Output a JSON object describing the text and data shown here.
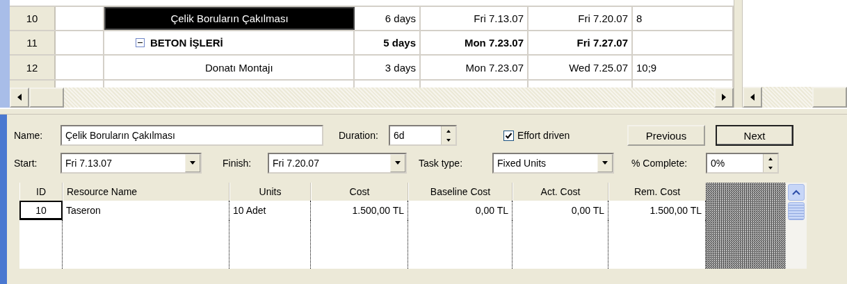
{
  "task_table": {
    "rows": [
      {
        "id": "10",
        "kind": "task",
        "name": "Çelik Boruların Çakılması",
        "duration": "6 days",
        "start": "Fri 7.13.07",
        "finish": "Fri 7.20.07",
        "predecessors": "8",
        "selected": true
      },
      {
        "id": "11",
        "kind": "summary",
        "expanded": true,
        "name": "BETON İŞLERİ",
        "duration": "5 days",
        "start": "Mon 7.23.07",
        "finish": "Fri 7.27.07",
        "selected": false
      },
      {
        "id": "12",
        "kind": "task",
        "name": "Donatı Montajı",
        "duration": "3 days",
        "start": "Mon 7.23.07",
        "finish": "Wed 7.25.07",
        "predecessors": "10;9",
        "selected": false
      }
    ]
  },
  "task_form": {
    "name_label": "Name:",
    "name": "Çelik Boruların Çakılması",
    "duration_label": "Duration:",
    "duration": "6d",
    "effort_driven": {
      "label": "Effort driven",
      "checked": true
    },
    "buttons": [
      {
        "label": "Previous",
        "default": false
      },
      {
        "label": "Next",
        "default": true
      }
    ],
    "start_label": "Start:",
    "start": "Fri 7.13.07",
    "finish_label": "Finish:",
    "finish": "Fri 7.20.07",
    "task_type_label": "Task type:",
    "task_type": "Fixed Units",
    "complete_label": "% Complete:",
    "complete": "0%"
  },
  "resource_table": {
    "columns": [
      "ID",
      "Resource Name",
      "Units",
      "Cost",
      "Baseline Cost",
      "Act. Cost",
      "Rem. Cost"
    ],
    "rows": [
      {
        "cells": [
          "10",
          "Taseron",
          "10 Adet",
          "1.500,00 TL",
          "0,00 TL",
          "0,00 TL",
          "1.500,00 TL"
        ],
        "selected": true
      }
    ]
  }
}
